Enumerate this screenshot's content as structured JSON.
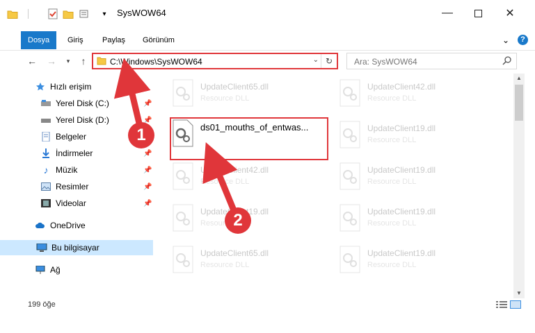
{
  "window": {
    "title": "SysWOW64"
  },
  "ribbon": {
    "tabs": [
      "Dosya",
      "Giriş",
      "Paylaş",
      "Görünüm"
    ],
    "help": "?"
  },
  "address": {
    "path": "C:\\Windows\\SysWOW64"
  },
  "search": {
    "placeholder": "Ara: SysWOW64"
  },
  "sidebar": {
    "quick_access": "Hızlı erişim",
    "items": [
      "Yerel Disk (C:)",
      "Yerel Disk (D:)",
      "Belgeler",
      "İndirmeler",
      "Müzik",
      "Resimler",
      "Videolar"
    ],
    "onedrive": "OneDrive",
    "this_pc": "Bu bilgisayar",
    "network": "Ağ"
  },
  "files": {
    "type_label": "Resource DLL",
    "main": "ds01_mouths_of_entwas...",
    "col1": [
      "UpdateClient65.dll",
      "UpdateClient42.dll",
      "UpdateClient19.dll",
      "UpdateClient65.dll"
    ],
    "col2": [
      "UpdateClient42.dll",
      "UpdateClient19.dll",
      "UpdateClient19.dll",
      "UpdateClient19.dll",
      "UpdateClient65.dll",
      "UpdateClient19.dll"
    ]
  },
  "status": {
    "count": "199 öğe"
  },
  "annotations": {
    "badge1": "1",
    "badge2": "2",
    "color": "#e0363a"
  },
  "colors": {
    "accent": "#1979ca",
    "selected": "#cce8ff"
  }
}
